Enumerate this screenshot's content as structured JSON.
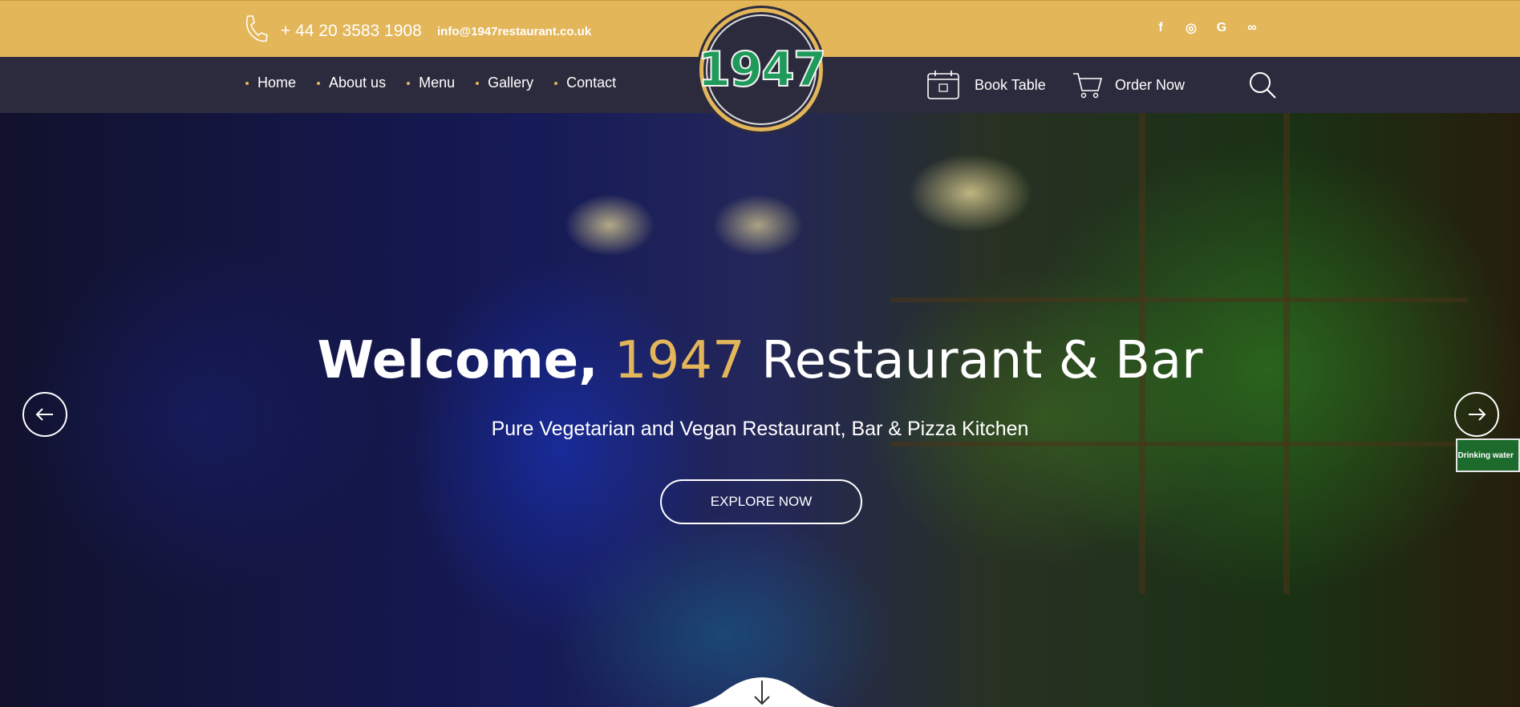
{
  "topbar": {
    "phone": "+ 44 20 3583 1908",
    "email": "info@1947restaurant.co.uk",
    "socials": [
      {
        "icon": "facebook-icon",
        "glyph": "f"
      },
      {
        "icon": "instagram-icon",
        "glyph": "◎"
      },
      {
        "icon": "google-icon",
        "glyph": "G"
      },
      {
        "icon": "tripadvisor-icon",
        "glyph": "∞"
      }
    ]
  },
  "nav": {
    "items": [
      {
        "label": "Home"
      },
      {
        "label": "About us"
      },
      {
        "label": "Menu"
      },
      {
        "label": "Gallery"
      },
      {
        "label": "Contact"
      }
    ],
    "book_table": "Book Table",
    "order_now": "Order Now"
  },
  "logo": {
    "text": "1947"
  },
  "hero": {
    "title_welcome": "Welcome,",
    "title_year": "1947",
    "title_rest": "Restaurant & Bar",
    "subtitle": "Pure Vegetarian and Vegan Restaurant, Bar & Pizza Kitchen",
    "cta": "EXPLORE NOW",
    "signage": "Drinking water"
  },
  "colors": {
    "accent": "#e3b65a",
    "nav_bg": "#2c2b3e",
    "logo_green": "#1f9a5a"
  }
}
